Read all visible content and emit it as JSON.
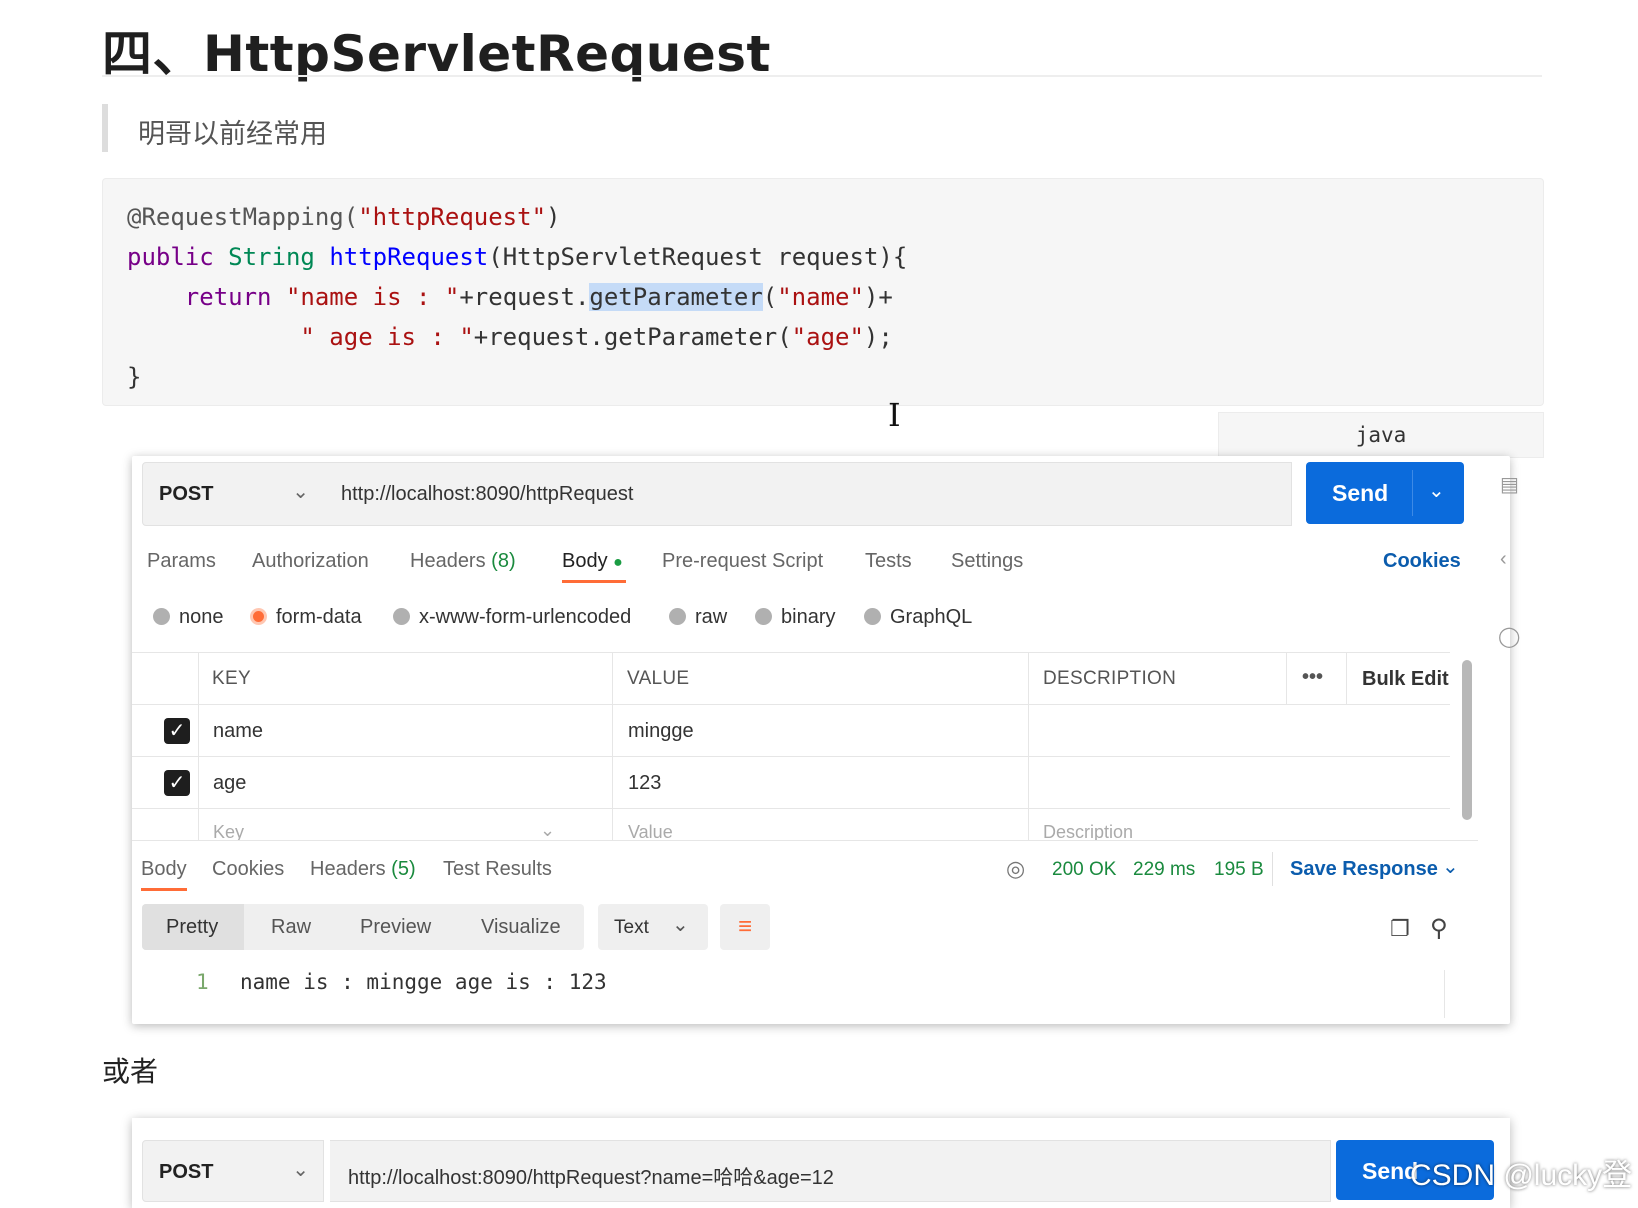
{
  "doc": {
    "heading": "四、HttpServletRequest",
    "quote": "明哥以前经常用",
    "code_lines": {
      "l1_annotation": "@RequestMapping(",
      "l1_string": "\"httpRequest\"",
      "l1_end": ")",
      "l2_public": "public",
      "l2_type": "String",
      "l2_method": "httpRequest",
      "l2_rest": "(HttpServletRequest request){",
      "l3_return": "return",
      "l3_str1": "\"name is : \"",
      "l3_mid": "+request.",
      "l3_selected": "getParameter",
      "l3_paren": "(",
      "l3_str2": "\"name\"",
      "l3_end": ")+",
      "l4_str1": "\" age is : \"",
      "l4_mid": "+request.getParameter(",
      "l4_str2": "\"age\"",
      "l4_end": ");",
      "l5": "}"
    },
    "code_language": "java",
    "or_text": "或者",
    "watermark": "CSDN @lucky登"
  },
  "request": {
    "method": "POST",
    "url": "http://localhost:8090/httpRequest",
    "send_label": "Send",
    "tabs": {
      "params": "Params",
      "authorization": "Authorization",
      "headers": "Headers",
      "headers_count": "(8)",
      "body": "Body",
      "pre_request": "Pre-request Script",
      "tests": "Tests",
      "settings": "Settings"
    },
    "cookies_link": "Cookies",
    "body_types": {
      "none": "none",
      "form_data": "form-data",
      "urlencoded": "x-www-form-urlencoded",
      "raw": "raw",
      "binary": "binary",
      "graphql": "GraphQL"
    },
    "table": {
      "key_header": "KEY",
      "value_header": "VALUE",
      "desc_header": "DESCRIPTION",
      "more": "•••",
      "bulk_edit": "Bulk Edit",
      "rows": [
        {
          "key": "name",
          "value": "mingge"
        },
        {
          "key": "age",
          "value": "123"
        }
      ],
      "placeholder_key": "Key",
      "placeholder_value": "Value",
      "placeholder_desc": "Description"
    }
  },
  "response": {
    "tabs": {
      "body": "Body",
      "cookies": "Cookies",
      "headers": "Headers",
      "headers_count": "(5)",
      "test_results": "Test Results"
    },
    "status": "200 OK",
    "time": "229 ms",
    "size": "195 B",
    "save_response": "Save Response",
    "views": {
      "pretty": "Pretty",
      "raw": "Raw",
      "preview": "Preview",
      "visualize": "Visualize"
    },
    "format": "Text",
    "line_number": "1",
    "output": "name is : mingge age is : 123"
  },
  "request2": {
    "method": "POST",
    "url": "http://localhost:8090/httpRequest?name=哈哈&age=12",
    "send_label": "Send"
  }
}
